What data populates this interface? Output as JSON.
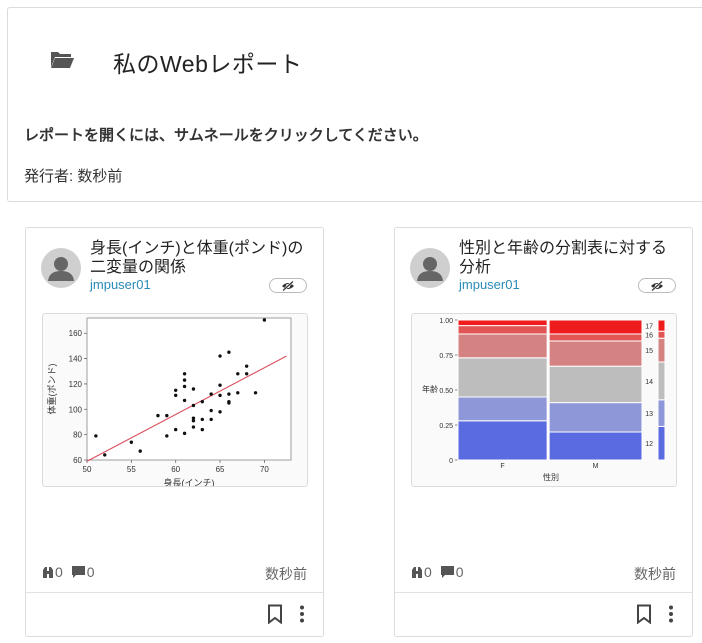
{
  "header": {
    "title": "私のWebレポート",
    "instruction": "レポートを開くには、サムネールをクリックしてください。",
    "publisher": "発行者: 数秒前"
  },
  "cards": [
    {
      "title": "身長(インチ)と体重(ポンド)の二変量の関係",
      "author": "jmpuser01",
      "views": "0",
      "comments": "0",
      "time": "数秒前"
    },
    {
      "title": "性別と年齢の分割表に対する分析",
      "author": "jmpuser01",
      "views": "0",
      "comments": "0",
      "time": "数秒前"
    }
  ],
  "chart_data": [
    {
      "type": "scatter",
      "title": "",
      "xlabel": "身長(インチ)",
      "ylabel": "体重(ポンド)",
      "xlim": [
        50,
        73
      ],
      "ylim": [
        60,
        172
      ],
      "xticks": [
        50,
        55,
        60,
        65,
        70
      ],
      "yticks": [
        60,
        80,
        100,
        120,
        140,
        160
      ],
      "points": [
        [
          51,
          79
        ],
        [
          52,
          64
        ],
        [
          55,
          74
        ],
        [
          56,
          67
        ],
        [
          58,
          95
        ],
        [
          59,
          95
        ],
        [
          59,
          79
        ],
        [
          60,
          84
        ],
        [
          60,
          111
        ],
        [
          60,
          115
        ],
        [
          61,
          81
        ],
        [
          61,
          107
        ],
        [
          61,
          118
        ],
        [
          61,
          123
        ],
        [
          61,
          128
        ],
        [
          62,
          86
        ],
        [
          62,
          91
        ],
        [
          62,
          93
        ],
        [
          62,
          103
        ],
        [
          62,
          116
        ],
        [
          63,
          84
        ],
        [
          63,
          92
        ],
        [
          63,
          106
        ],
        [
          64,
          92
        ],
        [
          64,
          99
        ],
        [
          64,
          112
        ],
        [
          65,
          98
        ],
        [
          65,
          111
        ],
        [
          65,
          119
        ],
        [
          65,
          142
        ],
        [
          66,
          105
        ],
        [
          66,
          106
        ],
        [
          66,
          112
        ],
        [
          66,
          145
        ],
        [
          67,
          128
        ],
        [
          67,
          113
        ],
        [
          68,
          128
        ],
        [
          68,
          134
        ],
        [
          69,
          113
        ],
        [
          70,
          172
        ]
      ],
      "fit_line": [
        [
          50,
          59
        ],
        [
          72.5,
          142
        ]
      ],
      "fit_color": "#d94f5c"
    },
    {
      "type": "mosaic",
      "title": "",
      "xlabel": "性別",
      "ylabel": "年齢",
      "categories": [
        "F",
        "M"
      ],
      "widths": [
        0.49,
        0.51
      ],
      "yticks": [
        "0",
        "0.25",
        "0.50",
        "0.75",
        "1.00"
      ],
      "age_levels": [
        "12",
        "13",
        "14",
        "15",
        "16",
        "17"
      ],
      "age_colors": [
        "#5a6ae0",
        "#8e97d8",
        "#bdbdbd",
        "#d48282",
        "#e25555",
        "#ee1c1c"
      ],
      "proportions": [
        [
          0.28,
          0.17,
          0.28,
          0.17,
          0.06,
          0.04
        ],
        [
          0.2,
          0.21,
          0.26,
          0.18,
          0.05,
          0.1
        ]
      ],
      "legend_proportions": [
        0.24,
        0.19,
        0.27,
        0.17,
        0.05,
        0.08
      ]
    }
  ]
}
